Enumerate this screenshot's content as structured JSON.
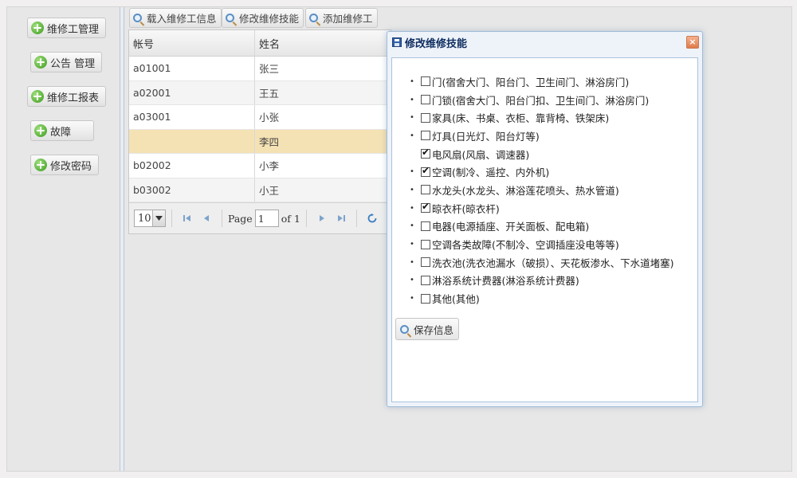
{
  "sidebar": {
    "items": [
      {
        "label": "维修工管理"
      },
      {
        "label": "公告 管理"
      },
      {
        "label": "维修工报表"
      },
      {
        "label": "故障"
      },
      {
        "label": "修改密码"
      }
    ]
  },
  "toolbar": {
    "load_label": "载入维修工信息",
    "edit_label": "修改维修技能",
    "add_label": "添加维修工"
  },
  "grid": {
    "columns": [
      "帐号",
      "姓名"
    ],
    "rows": [
      {
        "account": "a01001",
        "name": "张三"
      },
      {
        "account": "a02001",
        "name": "王五"
      },
      {
        "account": "a03001",
        "name": "小张"
      },
      {
        "account": "",
        "name": "李四",
        "selected": true
      },
      {
        "account": "b02002",
        "name": "小李"
      },
      {
        "account": "b03002",
        "name": "小王"
      }
    ]
  },
  "pager": {
    "page_size": "10",
    "page_label": "Page",
    "page_value": "1",
    "of_label": "of 1"
  },
  "dialog": {
    "title": "修改维修技能",
    "close_glyph": "×",
    "skills": [
      {
        "label": "门(宿舍大门、阳台门、卫生间门、淋浴房门)",
        "checked": false,
        "bullet": true
      },
      {
        "label": "门锁(宿舍大门、阳台门扣、卫生间门、淋浴房门)",
        "checked": false,
        "bullet": true
      },
      {
        "label": "家具(床、书桌、衣柜、靠背椅、铁架床)",
        "checked": false,
        "bullet": true
      },
      {
        "label": "灯具(日光灯、阳台灯等)",
        "checked": false,
        "bullet": true
      },
      {
        "label": "电风扇(风扇、调速器)",
        "checked": true,
        "bullet": false
      },
      {
        "label": "空调(制冷、遥控、内外机)",
        "checked": true,
        "bullet": true
      },
      {
        "label": "水龙头(水龙头、淋浴莲花喷头、热水管道)",
        "checked": false,
        "bullet": true
      },
      {
        "label": "晾衣杆(晾衣杆)",
        "checked": true,
        "bullet": true
      },
      {
        "label": "电器(电源插座、开关面板、配电箱)",
        "checked": false,
        "bullet": true
      },
      {
        "label": "空调各类故障(不制冷、空调插座没电等等)",
        "checked": false,
        "bullet": true
      },
      {
        "label": "洗衣池(洗衣池漏水（破损）、天花板渗水、下水道堵塞)",
        "checked": false,
        "bullet": true
      },
      {
        "label": "淋浴系统计费器(淋浴系统计费器)",
        "checked": false,
        "bullet": true
      },
      {
        "label": "其他(其他)",
        "checked": false,
        "bullet": true
      }
    ],
    "save_label": "保存信息"
  },
  "colors": {
    "selected_row": "#f5e2b4",
    "dialog_title": "#0e2d5f",
    "dialog_border": "#9fbcd9"
  }
}
